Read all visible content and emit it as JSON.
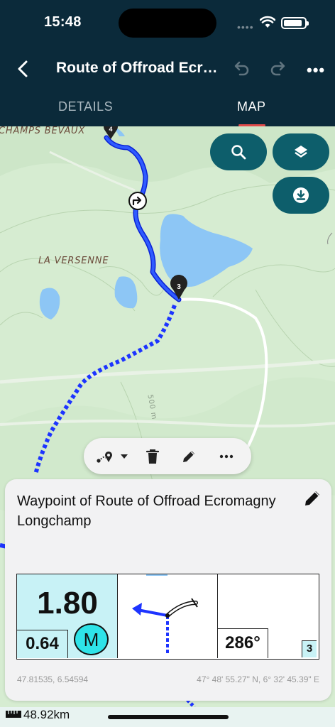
{
  "status": {
    "time": "15:48",
    "signal_dots": "••••"
  },
  "header": {
    "title": "Route of Offroad Ecr…",
    "tabs": [
      {
        "label": "DETAILS",
        "active": false
      },
      {
        "label": "MAP",
        "active": true
      }
    ]
  },
  "map": {
    "labels": {
      "place_1": "CHAMPS BEVAUX",
      "place_2": "LA VERSENNE",
      "elevation": "500 m"
    },
    "markers": {
      "waypoint_4": "4",
      "waypoint_3": "3"
    },
    "colors": {
      "route": "#1a3dff",
      "water": "#8dc6f5",
      "land": "#d7ecd3"
    }
  },
  "toolbar": {
    "icons": [
      "route-points-icon",
      "chevron-down-icon",
      "trash-icon",
      "pencil-icon",
      "more-icon"
    ]
  },
  "card": {
    "title": "Waypoint of Route of Offroad Ecromagny Longchamp",
    "navigation": {
      "distance": "1.80",
      "distance_sub": "0.64",
      "unit": "M",
      "bearing": "286°",
      "waypoint_number": "3"
    },
    "coords_decimal": "47.81535, 6.54594",
    "coords_dms": "47° 48' 55.27\" N, 6° 32' 45.39\" E"
  },
  "bottom": {
    "scale": "48.92km"
  }
}
